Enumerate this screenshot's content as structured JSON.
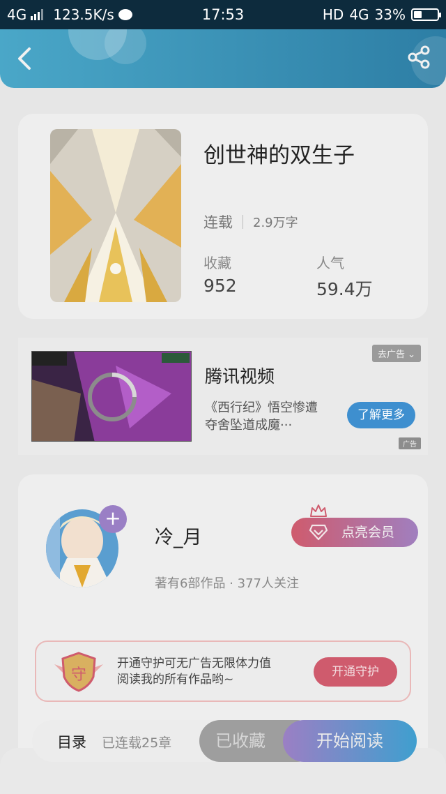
{
  "status_bar": {
    "network": "4G",
    "speed": "123.5K/s",
    "time": "17:53",
    "hd": "HD",
    "network_right": "4G",
    "battery": "33%",
    "battery_level": 0.33
  },
  "header": {
    "back_icon": "chevron-left-icon",
    "share_icon": "share-icon",
    "gradient": [
      "#4aa7c8",
      "#2d7ea5"
    ]
  },
  "book": {
    "title": "创世神的双生子",
    "status": "连载",
    "word_count": "2.9万字",
    "favorites_label": "收藏",
    "favorites_value": "952",
    "popularity_label": "人气",
    "popularity_value": "59.4万"
  },
  "ad": {
    "title": "腾讯视频",
    "description": "《西行纪》悟空惨遭夺舍坠道成魔···",
    "remove_label": "去广告",
    "learn_more": "了解更多",
    "tag": "广告"
  },
  "author": {
    "name": "冷_月",
    "follow_symbol": "+",
    "info": "著有6部作品 · 377人关注",
    "vip_button": "点亮会员",
    "guard_badge_char": "守",
    "guard_text_line1": "开通守护可无广告无限体力值",
    "guard_text_line2": "阅读我的所有作品哟~",
    "guard_button": "开通守护"
  },
  "bottom_bar": {
    "toc": "目录",
    "chapters": "已连载25章",
    "collected": "已收藏",
    "start_reading": "开始阅读"
  },
  "colors": {
    "accent_blue": "#3e8fcf",
    "accent_red": "#cf5b6d",
    "accent_purple": "#9b7fc4"
  }
}
